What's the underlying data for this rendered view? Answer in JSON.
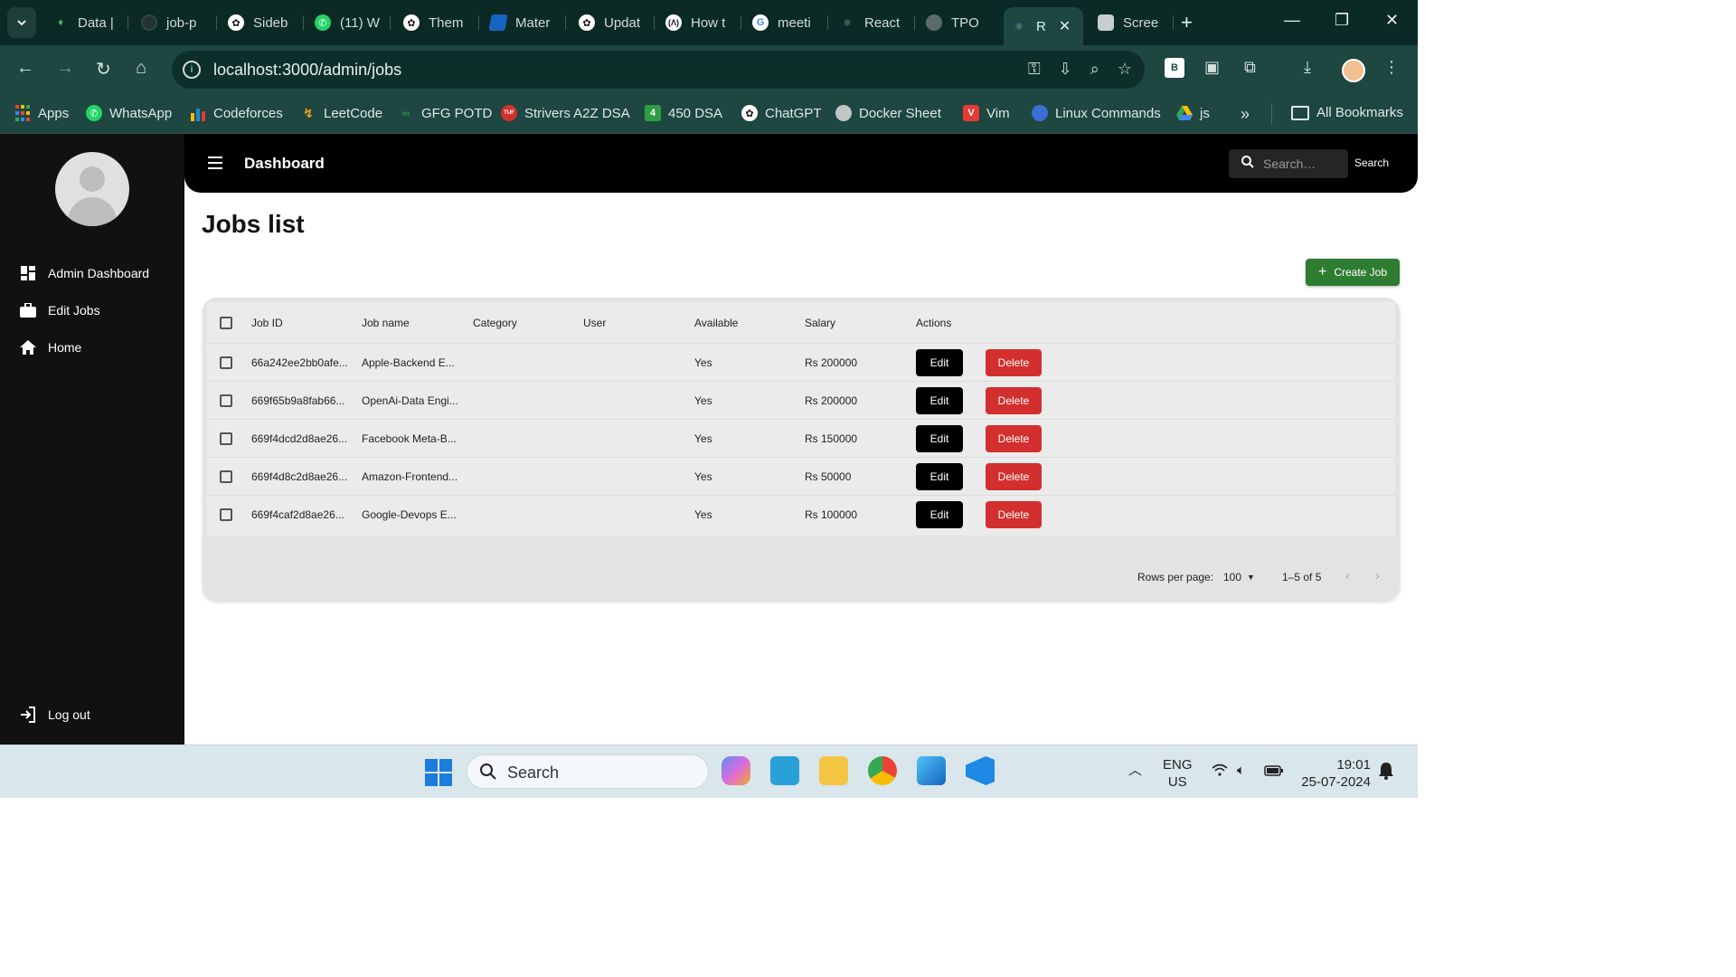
{
  "browser": {
    "tabs": [
      {
        "label": "Data |",
        "icon": "leaf-icon"
      },
      {
        "label": "job-p",
        "icon": "github-icon"
      },
      {
        "label": "Sideb",
        "icon": "openai-icon"
      },
      {
        "label": "(11) W",
        "icon": "whatsapp-icon"
      },
      {
        "label": "Them",
        "icon": "openai-icon"
      },
      {
        "label": "Mater",
        "icon": "mui-icon"
      },
      {
        "label": "Updat",
        "icon": "openai-icon"
      },
      {
        "label": "How t",
        "icon": "code-icon"
      },
      {
        "label": "meeti",
        "icon": "google-icon"
      },
      {
        "label": "React",
        "icon": "react-icon"
      },
      {
        "label": "TPO",
        "icon": "globe-icon"
      },
      {
        "label": "R",
        "icon": "react-icon"
      },
      {
        "label": "Scree",
        "icon": "camera-icon"
      }
    ],
    "url": "localhost:3000/admin/jobs",
    "bookmarks": [
      {
        "label": "Apps",
        "color": "#e94235"
      },
      {
        "label": "WhatsApp",
        "color": "#25d366"
      },
      {
        "label": "Codeforces",
        "color": "#1f8acb"
      },
      {
        "label": "LeetCode",
        "color": "#f89f1b"
      },
      {
        "label": "GFG POTD",
        "color": "#2f8d46"
      },
      {
        "label": "Strivers A2Z DSA",
        "color": "#d32f2f"
      },
      {
        "label": "450 DSA",
        "color": "#2e9e45"
      },
      {
        "label": "ChatGPT",
        "color": "#444444"
      },
      {
        "label": "Docker Sheet",
        "color": "#777777"
      },
      {
        "label": "Vim",
        "color": "#e53935"
      },
      {
        "label": "Linux Commands",
        "color": "#3b6fd6"
      },
      {
        "label": "js",
        "color": "#fbbc04"
      }
    ],
    "all_bookmarks": "All Bookmarks",
    "badge_4": "4",
    "badge_tuf": "TUF",
    "ext_b": "B"
  },
  "sidebar": {
    "items": [
      {
        "label": "Admin Dashboard"
      },
      {
        "label": "Edit Jobs"
      },
      {
        "label": "Home"
      }
    ],
    "logout": "Log out"
  },
  "appbar": {
    "title": "Dashboard",
    "search_placeholder": "Search…",
    "search_button": "Search"
  },
  "page": {
    "title": "Jobs list",
    "create_button": "Create Job"
  },
  "table": {
    "columns": [
      "Job ID",
      "Job name",
      "Category",
      "User",
      "Available",
      "Salary",
      "Actions"
    ],
    "rows": [
      {
        "id": "66a242ee2bb0afe...",
        "name": "Apple-Backend E...",
        "category": "",
        "user": "",
        "available": "Yes",
        "salary": "Rs 200000"
      },
      {
        "id": "669f65b9a8fab66...",
        "name": "OpenAi-Data Engi...",
        "category": "",
        "user": "",
        "available": "Yes",
        "salary": "Rs 200000"
      },
      {
        "id": "669f4dcd2d8ae26...",
        "name": "Facebook Meta-B...",
        "category": "",
        "user": "",
        "available": "Yes",
        "salary": "Rs 150000"
      },
      {
        "id": "669f4d8c2d8ae26...",
        "name": "Amazon-Frontend...",
        "category": "",
        "user": "",
        "available": "Yes",
        "salary": "Rs 50000"
      },
      {
        "id": "669f4caf2d8ae26...",
        "name": "Google-Devops E...",
        "category": "",
        "user": "",
        "available": "Yes",
        "salary": "Rs 100000"
      }
    ],
    "edit_label": "Edit",
    "delete_label": "Delete",
    "rows_per_page_label": "Rows per page:",
    "rows_per_page_value": "100",
    "range": "1–5 of 5"
  },
  "taskbar": {
    "search_label": "Search",
    "lang_1": "ENG",
    "lang_2": "US",
    "time": "19:01",
    "date": "25-07-2024"
  },
  "colors": {
    "create_green": "#2e7d32",
    "delete_red": "#d32f2f",
    "sidebar_bg": "#111111",
    "browser_teal": "#1d4740"
  }
}
